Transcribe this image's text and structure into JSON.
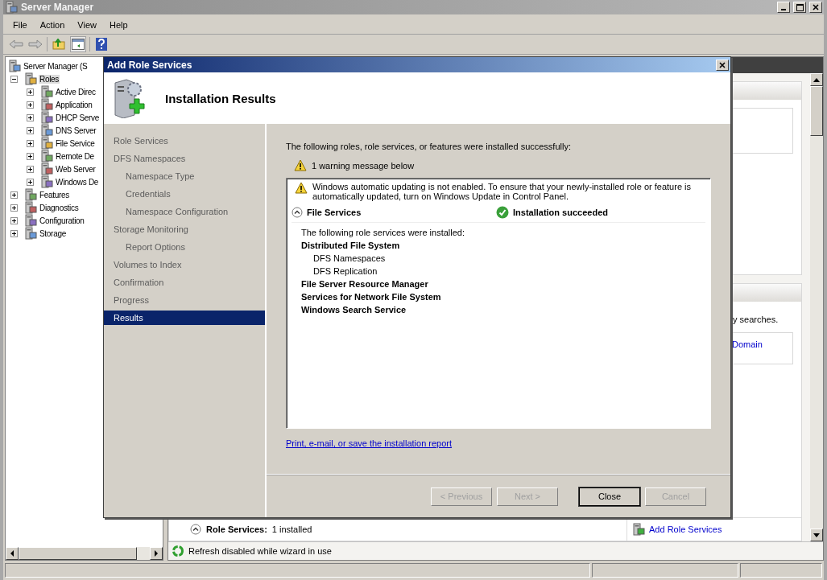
{
  "window": {
    "title": "Server Manager"
  },
  "menu": [
    {
      "label": "File"
    },
    {
      "label": "Action"
    },
    {
      "label": "View"
    },
    {
      "label": "Help"
    }
  ],
  "tree": {
    "items": [
      {
        "label": "Server Manager (S",
        "selected": false,
        "children": [
          {
            "label": "Roles",
            "expanded": true,
            "selected": true,
            "children": [
              {
                "label": "Active Direc",
                "expanded": false,
                "selected": false
              },
              {
                "label": "Application",
                "expanded": false,
                "selected": false
              },
              {
                "label": "DHCP Serve",
                "expanded": false,
                "selected": false
              },
              {
                "label": "DNS Server",
                "expanded": false,
                "selected": false
              },
              {
                "label": "File Service",
                "expanded": false,
                "selected": false
              },
              {
                "label": "Remote De",
                "expanded": false,
                "selected": false
              },
              {
                "label": "Web Server",
                "expanded": false,
                "selected": false
              },
              {
                "label": "Windows De",
                "expanded": false,
                "selected": false
              }
            ]
          },
          {
            "label": "Features",
            "expanded": false,
            "selected": false
          },
          {
            "label": "Diagnostics",
            "expanded": false,
            "selected": false
          },
          {
            "label": "Configuration",
            "expanded": false,
            "selected": false
          },
          {
            "label": "Storage",
            "expanded": false,
            "selected": false
          }
        ]
      }
    ]
  },
  "right_pane": {
    "search_text": "y searches.",
    "domain_link": "Domain",
    "role_services": {
      "label": "Role Services:",
      "value": "1 installed",
      "expanded": true
    },
    "add_role_services": "Add Role Services",
    "refresh_status": "Refresh disabled while wizard in use"
  },
  "dialog": {
    "title": "Add Role Services",
    "heading": "Installation Results",
    "steps": [
      {
        "label": "Role Services",
        "selected": false
      },
      {
        "label": "DFS Namespaces",
        "selected": false,
        "children": [
          {
            "label": "Namespace Type",
            "selected": false
          },
          {
            "label": "Credentials",
            "selected": false
          },
          {
            "label": "Namespace Configuration",
            "selected": false
          }
        ]
      },
      {
        "label": "Storage Monitoring",
        "selected": false,
        "children": [
          {
            "label": "Report Options",
            "selected": false
          }
        ]
      },
      {
        "label": "Volumes to Index",
        "selected": false
      },
      {
        "label": "Confirmation",
        "selected": false
      },
      {
        "label": "Progress",
        "selected": false
      },
      {
        "label": "Results",
        "selected": true
      }
    ],
    "intro": "The following roles, role services, or features were installed successfully:",
    "warning_summary": "1 warning message below",
    "warning_detail": "Windows automatic updating is not enabled. To ensure that your newly-installed role or feature is automatically updated, turn on Windows Update in Control Panel.",
    "result": {
      "role": "File Services",
      "expanded": true,
      "status": "Installation succeeded",
      "intro": "The following role services were installed:",
      "services": [
        {
          "label": "Distributed File System",
          "children": [
            {
              "label": "DFS Namespaces"
            },
            {
              "label": "DFS Replication"
            }
          ]
        },
        {
          "label": "File Server Resource Manager"
        },
        {
          "label": "Services for Network File System"
        },
        {
          "label": "Windows Search Service"
        }
      ]
    },
    "report_link": "Print, e-mail, or save the installation report",
    "buttons": [
      {
        "label": "< Previous",
        "disabled": true,
        "default": false
      },
      {
        "label": "Next >",
        "disabled": true,
        "default": false
      },
      {
        "label": "Close",
        "disabled": false,
        "default": true
      },
      {
        "label": "Cancel",
        "disabled": true,
        "default": false
      }
    ]
  }
}
